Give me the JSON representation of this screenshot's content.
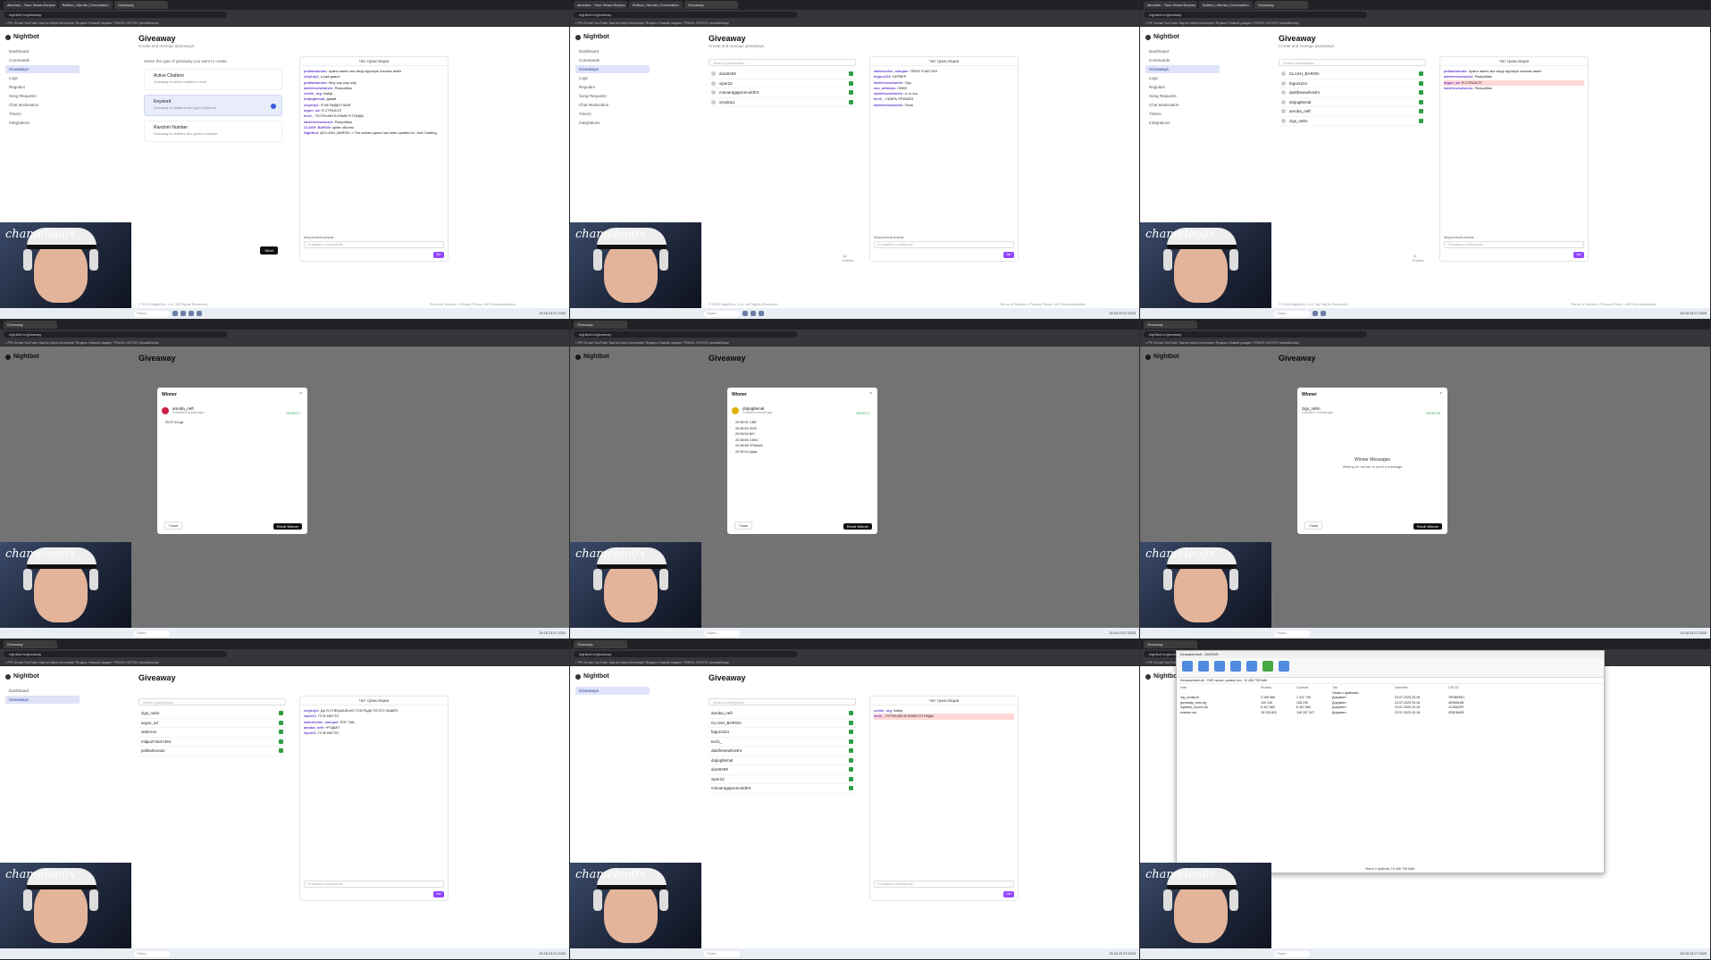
{
  "browser": {
    "tabs": [
      "alexdars - Твои Знаки Вопрос",
      "Войны | Alertas | Donanation",
      "Giveaway"
    ],
    "url": "nightbot.tv/giveaway",
    "bookmarks": "• РФ Gmail   YouTube   Карты   https://example   Яндекс   Новый раздел   ТРАНС-НОТОУ   plzstolfixday",
    "all_bookmarks": "Все закладки"
  },
  "app": {
    "brand": "Nightbot",
    "nav": [
      "Dashboard",
      "Commands",
      "Giveaways",
      "Logs",
      "Regulars",
      "Song Requests",
      "Chat Moderation",
      "Timers",
      "Integrations"
    ],
    "title": "Giveaway",
    "subtitle": "Create and manage giveaways.",
    "footer": "© 2025 NightDev, LLC. All Rights Reserved.",
    "footer_links": "Terms of Service • Privacy Policy • API Documentation"
  },
  "types": {
    "heading": "Select the type of giveaway you want to create.",
    "items": [
      {
        "name": "Active Chatters",
        "desc": "Giveaway to active chatters in chat"
      },
      {
        "name": "Keyword",
        "desc": "Giveaway to chatters who type a keyword"
      },
      {
        "name": "Random Number",
        "desc": "Giveaway to chatters who guess a number"
      }
    ],
    "send": "Send"
  },
  "participants": {
    "search": "Search participants...",
    "names": [
      "dunt0409",
      "viper22",
      "minoeragapronnoldKX",
      "vizykrip1",
      "CLASH_BARON",
      "fegurs224",
      "darkfresewhoishr",
      "dotjogtlemal",
      "amoba_neft",
      "zigs_nahn"
    ],
    "names2": [
      "zigs_nahn",
      "argon_sd",
      "watrcros",
      "milpo274647464",
      "polikarkonutv",
      "amoba_neft",
      "CLASH_BARON",
      "fegurs224",
      "tecl1_",
      "darkfresewhoishr",
      "dotjogtlemal",
      "dunt0409",
      "viper22",
      "minoeragapronnoldKX"
    ],
    "count": "16 Entries"
  },
  "chat": {
    "header": "Чат трансляции",
    "mode": "Медленный режим",
    "placeholder": "Отправить сообщение",
    "button": "Чат",
    "messages": [
      {
        "user": "polikarkonutv",
        "text": "нужно иметь все меру вручную лишних имён"
      },
      {
        "user": "vizykrip1",
        "text": "я уже давно"
      },
      {
        "user": "polikarkonutv",
        "text": "Why any way why"
      },
      {
        "user": "darkfresewhoishr",
        "text": "Разграбим"
      },
      {
        "user": "cedrik_org",
        "text": "Кайф"
      },
      {
        "user": "dotjogtlemal",
        "text": "давай"
      },
      {
        "user": "vizykrip1",
        "text": "Я НЕ ВИДЕО МОЁ"
      },
      {
        "user": "argon_sd",
        "text": "Я СТРАЛСЯ"
      },
      {
        "user": "tecl1_",
        "text": "ПОТНЫЛИ В ИЗМИ Я ГНИДА"
      },
      {
        "user": "darkfresewhoishr",
        "text": "Разграбим"
      },
      {
        "user": "CLASH_BARON",
        "text": "Ignite обычно"
      },
      {
        "user": "Nightbot",
        "text": "@CLASH_BARON -> The stream game has been updated to: Just Chatting"
      }
    ],
    "messages2": [
      {
        "user": "watermelon_nwnpax",
        "text": "ТЕБЯ! УЧАСТНИ"
      },
      {
        "user": "vizykrip1",
        "text": "ДА Я СПЕЦИАЛЬНО ТОК РАДИ ЭТОГО ЗАШЁЛ"
      },
      {
        "user": "viper22",
        "text": "ГО В МЕСТО"
      },
      {
        "user": "watermelon_nwnpax",
        "text": "ПОГ ТАБ"
      },
      {
        "user": "amoba_neft",
        "text": "+РОДИЛ"
      },
      {
        "user": "viper22",
        "text": "ГО В МЕСТО"
      },
      {
        "user": "fegurs224",
        "text": "СЕРВЕР"
      },
      {
        "user": "darkfresewhoishr",
        "text": "Ору"
      },
      {
        "user": "sus_arbinalu",
        "text": "СВИН"
      },
      {
        "user": "darkfresewhoishr",
        "text": "А то это"
      },
      {
        "user": "tecl1_",
        "text": "СБАРЬ ПРИШЁЛ"
      },
      {
        "user": "darkfresewhoishr",
        "text": "Пипа"
      }
    ]
  },
  "modal": {
    "title": "Winner",
    "close": "Close",
    "reroll": "Reroll Winner",
    "winners": [
      {
        "name": "amoba_neft",
        "sub": "Followed 6 months ago",
        "time": "00:00:17",
        "msg": "20:37:44  да"
      },
      {
        "name": "dotjogtlemal",
        "sub": "Followed a month ago",
        "time": "00:00:17",
        "msgs": [
          "20:38:51  СВЕ",
          "20:38:53  ФОС",
          "20:38:54  В/С",
          "20:38:55  СЕКС",
          "20:38:58  УРАААА",
          "20:39:04  урра"
        ]
      },
      {
        "name": "zigs_nahn",
        "sub": "Followed 3 months ago",
        "time": "00:00:10",
        "wait_title": "Winner Messages",
        "wait_text": "Waiting for winner to send a message"
      }
    ]
  },
  "explorer": {
    "title": "Безымянный - WinRAR",
    "path": "Безымянный.rar - RAR архив, размер исх. 10 456 798 байт",
    "columns": [
      "Имя",
      "Размер",
      "Сжатый",
      "Тип",
      "Изменён",
      "CRC32"
    ],
    "rows": [
      [
        "..",
        "",
        "",
        "Папка с файлами",
        "",
        ""
      ],
      [
        "log_config.txt",
        "3 198 980",
        "1 011 795",
        "Документ",
        "23.07.2025 20:18",
        "7EEBB9D1"
      ],
      [
        "giveaway_sets.cfg",
        "190 125",
        "138 230",
        "Документ",
        "23.07.2025 20:18",
        "4E2684AB"
      ],
      [
        "nightbot_export.csv",
        "6 407 660",
        "6 407 660",
        "Документ",
        "23.07.2025 20:18",
        "1C56A3FE"
      ],
      [
        "readme.md",
        "15 225 823",
        "146 357 927",
        "Документ",
        "23.07.2025 20:18",
        "4F8D5A2B"
      ]
    ],
    "status": "Всего 5 файлов, 10 456 798 байт"
  },
  "stream": {
    "overlay": "chameleo0x"
  },
  "taskbar": {
    "search": "Поиск",
    "clock": "20:18\n23.07.2025"
  }
}
